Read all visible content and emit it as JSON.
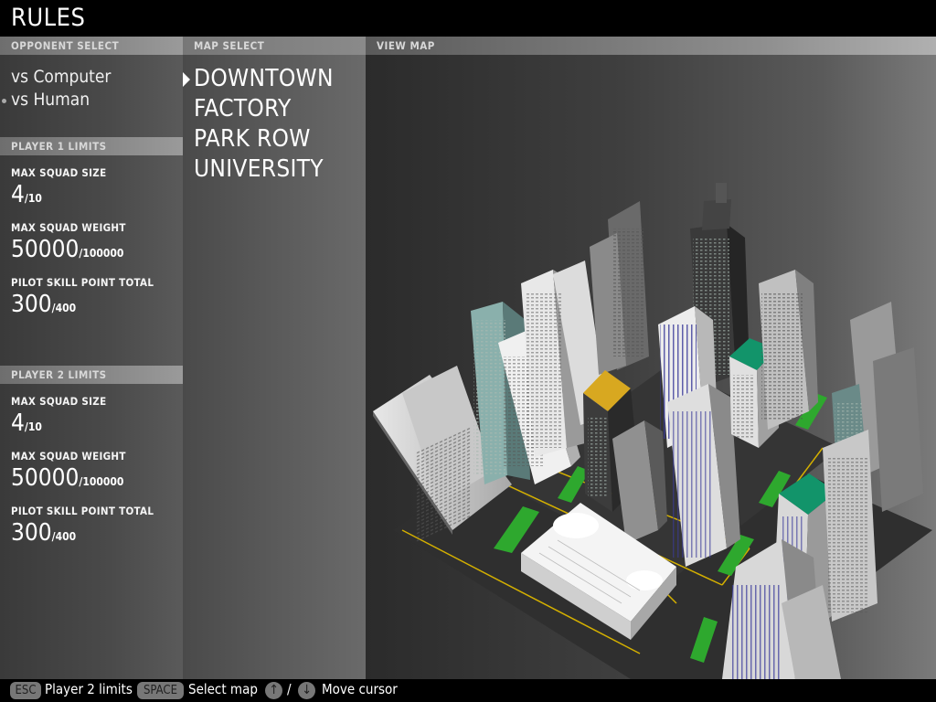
{
  "title": "RULES",
  "opponent_select": {
    "header": "OPPONENT SELECT",
    "options": [
      "vs Computer",
      "vs Human"
    ]
  },
  "map_select": {
    "header": "MAP SELECT",
    "maps": [
      "DOWNTOWN",
      "FACTORY",
      "PARK ROW",
      "UNIVERSITY"
    ]
  },
  "view_map": {
    "header": "VIEW MAP"
  },
  "player1": {
    "header": "PLAYER 1 LIMITS",
    "squad_size_label": "MAX SQUAD SIZE",
    "squad_size_value": "4",
    "squad_size_max": "/10",
    "squad_weight_label": "MAX SQUAD WEIGHT",
    "squad_weight_value": "50000",
    "squad_weight_max": "/100000",
    "skill_label": "PILOT SKILL POINT TOTAL",
    "skill_value": "300",
    "skill_max": "/400"
  },
  "player2": {
    "header": "PLAYER 2 LIMITS",
    "squad_size_label": "MAX SQUAD SIZE",
    "squad_size_value": "4",
    "squad_size_max": "/10",
    "squad_weight_label": "MAX SQUAD WEIGHT",
    "squad_weight_value": "50000",
    "squad_weight_max": "/100000",
    "skill_label": "PILOT SKILL POINT TOTAL",
    "skill_value": "300",
    "skill_max": "/400"
  },
  "footer": {
    "esc_key": "ESC",
    "esc_text": "Player 2 limits",
    "space_key": "SPACE",
    "space_text": "Select map",
    "up_key": "↑",
    "separator": "/",
    "down_key": "↓",
    "arrows_text": "Move cursor"
  },
  "colors": {
    "road": "#2f2f2f",
    "lane_marking": "#d4b000",
    "park": "#2ea82e",
    "green_roof": "#12946a",
    "gold_roof": "#d8a820"
  }
}
